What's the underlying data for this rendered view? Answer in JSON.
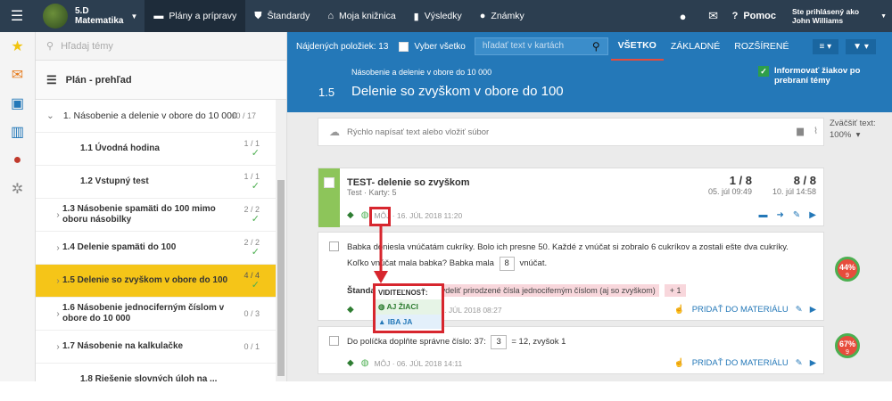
{
  "topbar": {
    "class_number": "5.D",
    "class_subject": "Matematika",
    "nav": [
      {
        "label": "Plány a prípravy",
        "icon": "folder-icon",
        "active": true
      },
      {
        "label": "Štandardy",
        "icon": "shield-icon"
      },
      {
        "label": "Moja knižnica",
        "icon": "library-icon"
      },
      {
        "label": "Výsledky",
        "icon": "chart-icon"
      },
      {
        "label": "Známky",
        "icon": "grade-icon"
      }
    ],
    "help": "Pomoc",
    "user_label": "Ste prihlásený ako",
    "user_name": "John Williams"
  },
  "left": {
    "search_placeholder": "Hľadaj témy",
    "plan_title": "Plán - prehľad",
    "topic": {
      "title": "1. Násobenie a delenie v obore do 10 000",
      "count": "10 / 17"
    },
    "lessons": [
      {
        "title": "1.1 Úvodná hodina",
        "count": "1 / 1",
        "done": true
      },
      {
        "title": "1.2 Vstupný test",
        "count": "1 / 1",
        "done": true
      },
      {
        "title": "1.3 Násobenie spamäti do 100 mimo oboru násobilky",
        "count": "2 / 2",
        "done": true
      },
      {
        "title": "1.4 Delenie spamäti do 100",
        "count": "2 / 2",
        "done": true
      },
      {
        "title": "1.5 Delenie so zvyškom v obore do 100",
        "count": "4 / 4",
        "done": true,
        "active": true
      },
      {
        "title": "1.6 Násobenie jednociferným číslom v obore do 10 000",
        "count": "0 / 3"
      },
      {
        "title": "1.7 Násobenie na kalkulačke",
        "count": "0 / 1"
      },
      {
        "title": "1.8 Riešenie slovných úloh na ...",
        "count": ""
      }
    ]
  },
  "toolbar": {
    "found_label": "Nájdených položiek:",
    "found_count": "13",
    "select_all": "Vyber všetko",
    "search_placeholder": "hľadať text v kartách",
    "tabs": [
      "VŠETKO",
      "ZÁKLADNÉ",
      "ROZŠÍRENÉ"
    ]
  },
  "header": {
    "subtitle": "Násobenie a delenie v obore do 10 000",
    "number": "1.5",
    "title": "Delenie so zvyškom v obore do 100",
    "notify": "Informovať žiakov po prebraní témy"
  },
  "zoom": {
    "label": "Zväčšiť text:",
    "value": "100%"
  },
  "quick": {
    "placeholder": "Rýchlo napísať text alebo vložiť súbor"
  },
  "test": {
    "title": "TEST- delenie so zvyškom",
    "meta": "Test · Karty: 5",
    "stat1_value": "1 / 8",
    "stat1_date": "05. júl 09:49",
    "stat2_value": "8 / 8",
    "stat2_date": "10. júl 14:58",
    "foot": "MÔJ  ·  16. JÚL 2018 11:20"
  },
  "q1": {
    "text_a": "Babka doniesla vnúčatám cukríky. Bolo ich presne 50. Každé z vnúčat si zobralo 6 cukríkov a zostali ešte dva cukríky. Koľko vnúčat mala babka? Babka mala",
    "answer": "8",
    "text_b": "vnúčat.",
    "std_label": "Štandard:",
    "std": "vynásobiť a vydeliť prirodzené čísla jednociferným číslom (aj so zvyškom)",
    "std_plus": "+ 1",
    "foot": "13. JÚL 2018 08:27",
    "add": "PRIDAŤ DO MATERIÁLU",
    "pct": "44%",
    "pct_count": "9"
  },
  "q2": {
    "text_a": "Do políčka doplňte správne číslo: 37:",
    "answer": "3",
    "text_b": "= 12, zvyšok 1",
    "foot": "MÔJ  ·  06. JÚL 2018 14:11",
    "add": "PRIDAŤ DO MATERIÁLU",
    "pct": "67%",
    "pct_count": "9"
  },
  "visibility": {
    "title": "VIDITEĽNOSŤ:",
    "opt1": "AJ ŽIACI",
    "opt2": "IBA JA"
  },
  "colors": {
    "topbar": "#2c3e50",
    "accent": "#2478b8",
    "active_lesson": "#f5c518",
    "highlight": "#d7262e"
  }
}
